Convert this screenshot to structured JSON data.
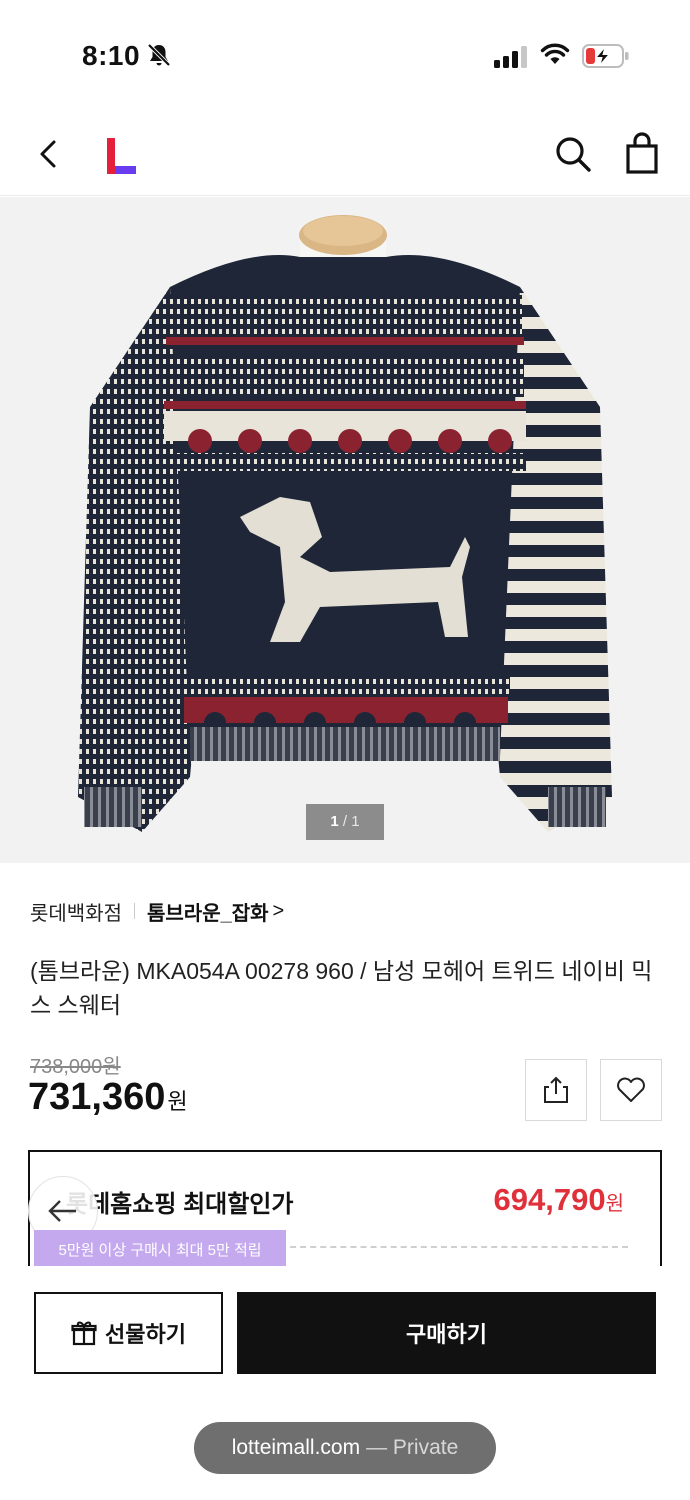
{
  "status_bar": {
    "time": "8:10",
    "icons": [
      "bell-slash-icon",
      "signal-icon",
      "wifi-icon",
      "battery-charging-icon"
    ],
    "battery_color": "#e5393a"
  },
  "nav": {
    "icons": [
      "chevron-left-icon",
      "lotte-logo",
      "search-icon",
      "shopping-bag-icon"
    ],
    "logo_colors": [
      "#e5203a",
      "#6a3cf0"
    ]
  },
  "gallery": {
    "current": "1",
    "separator": "/",
    "total": "1"
  },
  "product": {
    "store": "롯데백화점",
    "shop": "톰브라운_잡화",
    "shop_chevron": ">",
    "title": "(톰브라운) MKA054A 00278 960 / 남성 모헤어 트위드 네이비 믹스 스웨터",
    "original_price": "738,000원",
    "price": "731,360",
    "price_unit": "원"
  },
  "promo": {
    "label": "롯데홈쇼핑 최대할인가",
    "price": "694,790",
    "price_unit": "원",
    "tooltip": "5만원 이상 구매시 최대 5만 적립",
    "accent_color": "#e0313b",
    "tooltip_color": "#c5a9ee"
  },
  "actions": {
    "gift_label": "선물하기",
    "buy_label": "구매하기"
  },
  "browser": {
    "domain": "lotteimall.com",
    "mode": "— Private"
  }
}
